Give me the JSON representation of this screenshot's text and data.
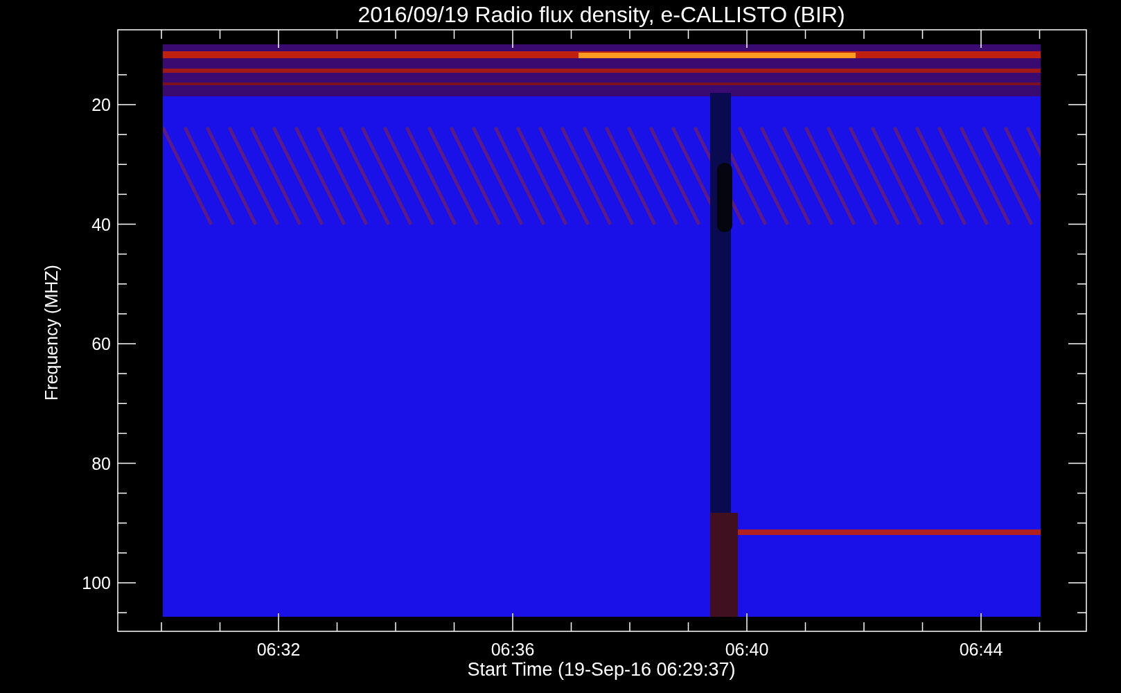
{
  "title": "2016/09/19  Radio flux density, e-CALLISTO (BIR)",
  "y_axis": {
    "label": "Frequency (MHZ)",
    "ticks": [
      "20",
      "40",
      "60",
      "80",
      "100"
    ]
  },
  "x_axis": {
    "label": "Start Time (19-Sep-16 06:29:37)",
    "ticks": [
      "06:32",
      "06:36",
      "06:40",
      "06:44"
    ]
  }
}
